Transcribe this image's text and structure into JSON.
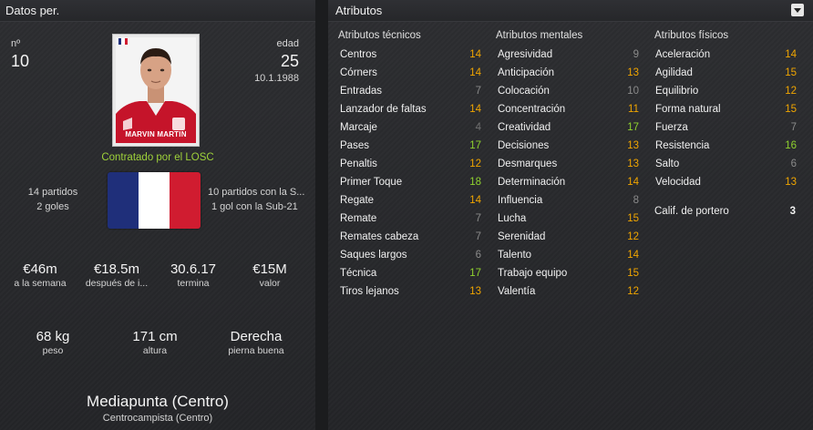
{
  "left_panel": {
    "header": "Datos per.",
    "number_label": "nº",
    "number": "10",
    "age_label": "edad",
    "age": "25",
    "dob": "10.1.1988",
    "photo_caption": "MARVIN MARTIN",
    "contract": "Contratado por el LOSC",
    "club_apps": "14 partidos",
    "club_goals": "2 goles",
    "intl_apps": "10 partidos con la S...",
    "intl_goals": "1 gol con la Sub-21",
    "flag_colors": [
      "#1f2f7a",
      "#ffffff",
      "#d01c30"
    ],
    "stats": [
      {
        "value": "€46m",
        "label": "a la semana"
      },
      {
        "value": "€18.5m",
        "label": "después de i..."
      },
      {
        "value": "30.6.17",
        "label": "termina"
      },
      {
        "value": "€15M",
        "label": "valor"
      }
    ],
    "physical": [
      {
        "value": "68 kg",
        "label": "peso"
      },
      {
        "value": "171 cm",
        "label": "altura"
      },
      {
        "value": "Derecha",
        "label": "pierna buena"
      }
    ],
    "position": "Mediapunta (Centro)",
    "position_sub": "Centrocampista (Centro)"
  },
  "right_panel": {
    "header": "Atributos",
    "technical": {
      "title": "Atributos técnicos",
      "items": [
        {
          "name": "Centros",
          "value": "14",
          "color": "orange"
        },
        {
          "name": "Córners",
          "value": "14",
          "color": "orange"
        },
        {
          "name": "Entradas",
          "value": "7",
          "color": "grey"
        },
        {
          "name": "Lanzador de faltas",
          "value": "14",
          "color": "orange"
        },
        {
          "name": "Marcaje",
          "value": "4",
          "color": "dgrey"
        },
        {
          "name": "Pases",
          "value": "17",
          "color": "green"
        },
        {
          "name": "Penaltis",
          "value": "12",
          "color": "orange"
        },
        {
          "name": "Primer Toque",
          "value": "18",
          "color": "green"
        },
        {
          "name": "Regate",
          "value": "14",
          "color": "orange"
        },
        {
          "name": "Remate",
          "value": "7",
          "color": "grey"
        },
        {
          "name": "Remates cabeza",
          "value": "7",
          "color": "grey"
        },
        {
          "name": "Saques largos",
          "value": "6",
          "color": "grey"
        },
        {
          "name": "Técnica",
          "value": "17",
          "color": "green"
        },
        {
          "name": "Tiros lejanos",
          "value": "13",
          "color": "orange"
        }
      ]
    },
    "mental": {
      "title": "Atributos mentales",
      "items": [
        {
          "name": "Agresividad",
          "value": "9",
          "color": "grey"
        },
        {
          "name": "Anticipación",
          "value": "13",
          "color": "orange"
        },
        {
          "name": "Colocación",
          "value": "10",
          "color": "grey"
        },
        {
          "name": "Concentración",
          "value": "11",
          "color": "orange"
        },
        {
          "name": "Creatividad",
          "value": "17",
          "color": "green"
        },
        {
          "name": "Decisiones",
          "value": "13",
          "color": "orange"
        },
        {
          "name": "Desmarques",
          "value": "13",
          "color": "orange"
        },
        {
          "name": "Determinación",
          "value": "14",
          "color": "orange"
        },
        {
          "name": "Influencia",
          "value": "8",
          "color": "grey"
        },
        {
          "name": "Lucha",
          "value": "15",
          "color": "orange"
        },
        {
          "name": "Serenidad",
          "value": "12",
          "color": "orange"
        },
        {
          "name": "Talento",
          "value": "14",
          "color": "orange"
        },
        {
          "name": "Trabajo equipo",
          "value": "15",
          "color": "orange"
        },
        {
          "name": "Valentía",
          "value": "12",
          "color": "orange"
        }
      ]
    },
    "physical": {
      "title": "Atributos físicos",
      "items": [
        {
          "name": "Aceleración",
          "value": "14",
          "color": "orange"
        },
        {
          "name": "Agilidad",
          "value": "15",
          "color": "orange"
        },
        {
          "name": "Equilibrio",
          "value": "12",
          "color": "orange"
        },
        {
          "name": "Forma natural",
          "value": "15",
          "color": "orange"
        },
        {
          "name": "Fuerza",
          "value": "7",
          "color": "grey"
        },
        {
          "name": "Resistencia",
          "value": "16",
          "color": "green"
        },
        {
          "name": "Salto",
          "value": "6",
          "color": "grey"
        },
        {
          "name": "Velocidad",
          "value": "13",
          "color": "orange"
        }
      ]
    },
    "goalkeeper_label": "Calif. de portero",
    "goalkeeper_value": "3"
  }
}
